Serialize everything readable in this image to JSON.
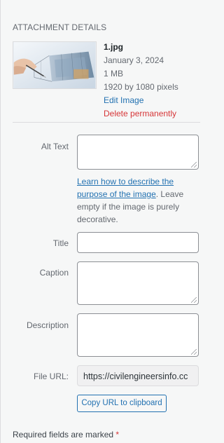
{
  "section_title": "ATTACHMENT DETAILS",
  "attachment": {
    "filename": "1.jpg",
    "date": "January 3, 2024",
    "size": "1 MB",
    "dimensions": "1920 by 1080 pixels",
    "edit_link": "Edit Image",
    "delete_link": "Delete permanently"
  },
  "fields": {
    "alt_text_label": "Alt Text",
    "alt_text_value": "",
    "alt_help_link": "Learn how to describe the purpose of the image",
    "alt_help_rest": ". Leave empty if the image is purely decorative.",
    "title_label": "Title",
    "title_value": "",
    "caption_label": "Caption",
    "caption_value": "",
    "description_label": "Description",
    "description_value": "",
    "file_url_label": "File URL:",
    "file_url_value": "https://civilengineersinfo.cc"
  },
  "copy_button": "Copy URL to clipboard",
  "required_note": "Required fields are marked",
  "required_star": "*",
  "colors": {
    "link": "#2271b1",
    "delete": "#d63638",
    "border": "#8c8f94",
    "background": "#f6f7f7"
  }
}
